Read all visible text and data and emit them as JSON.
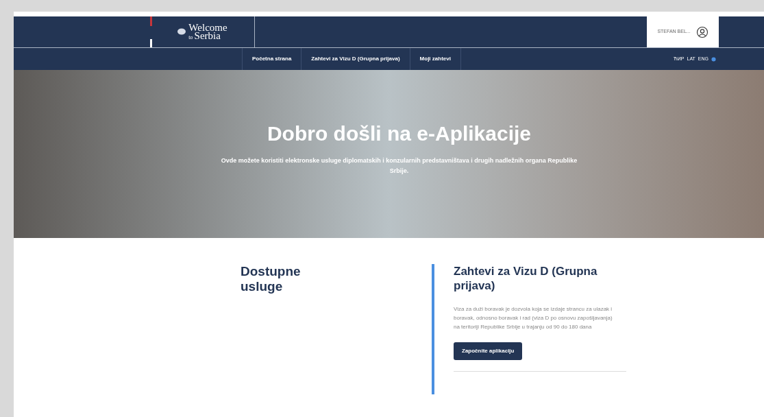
{
  "header": {
    "logo": {
      "line_1": "Welcome",
      "line_2": "to",
      "line_3": "Serbia"
    },
    "user": "STEFAN BEL..."
  },
  "nav": {
    "items": [
      "Početna strana",
      "Zahtevi za Vizu D (Grupna prijava)",
      "Moji zahtevi"
    ],
    "languages": [
      "ЋИР",
      "LAT",
      "ENG"
    ]
  },
  "hero": {
    "title": "Dobro došli na e-Aplikacije",
    "subtitle": "Ovde možete koristiti elektronske usluge diplomatskih i konzularnih predstavništava i drugih nadležnih organa Republike Srbije."
  },
  "services": {
    "heading": "Dostupne usluge",
    "cards": [
      {
        "title": "Zahtevi za Vizu D (Grupna prijava)",
        "description": "Viza za duži boravak je dozvola koja se izdaje strancu za ulazak i boravak, odnosno boravak i rad (viza D po osnovu zapošljavanja) na teritoriji Republike Srbije u trajanju od 90 do 180 dana",
        "button": "Započnite aplikaciju"
      }
    ]
  }
}
